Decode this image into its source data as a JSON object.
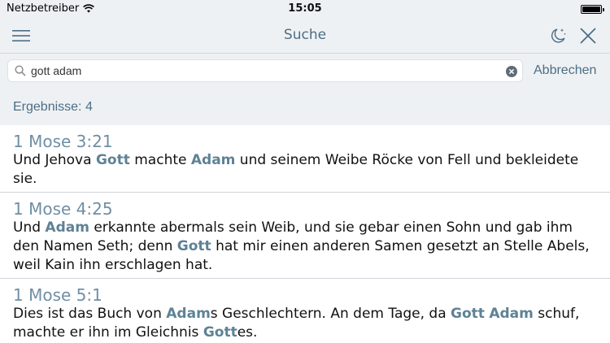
{
  "status_bar": {
    "carrier": "Netzbetreiber",
    "time": "15:05"
  },
  "nav": {
    "title": "Suche",
    "icons": [
      "menu-icon",
      "night-mode-icon",
      "close-icon"
    ]
  },
  "search": {
    "value": "gott adam",
    "cancel_label": "Abbrechen"
  },
  "results_label": "Ergebnisse: 4",
  "colors": {
    "accent": "#4d6e84",
    "highlight": "#5e8295",
    "reference": "#6f8fa4",
    "bar_background": "#eef1f4"
  },
  "results": [
    {
      "reference": "1 Mose 3:21",
      "segments": [
        {
          "t": "Und Jehova "
        },
        {
          "t": "Gott",
          "h": true
        },
        {
          "t": " machte "
        },
        {
          "t": "Adam",
          "h": true
        },
        {
          "t": " und seinem Weibe Röcke von Fell und bekleidete sie."
        }
      ]
    },
    {
      "reference": "1 Mose 4:25",
      "segments": [
        {
          "t": "Und "
        },
        {
          "t": "Adam",
          "h": true
        },
        {
          "t": " erkannte abermals sein Weib, und sie gebar einen Sohn und gab ihm den Namen Seth; denn "
        },
        {
          "t": "Gott",
          "h": true
        },
        {
          "t": " hat mir einen anderen Samen gesetzt an Stelle Abels, weil Kain ihn erschlagen hat."
        }
      ]
    },
    {
      "reference": "1 Mose 5:1",
      "segments": [
        {
          "t": "Dies ist das Buch von "
        },
        {
          "t": "Adam",
          "h": true
        },
        {
          "t": "s Geschlechtern. An dem Tage, da "
        },
        {
          "t": "Gott",
          "h": true
        },
        {
          "t": " "
        },
        {
          "t": "Adam",
          "h": true
        },
        {
          "t": " schuf, machte er ihn im Gleichnis "
        },
        {
          "t": "Gott",
          "h": true
        },
        {
          "t": "es."
        }
      ]
    }
  ]
}
